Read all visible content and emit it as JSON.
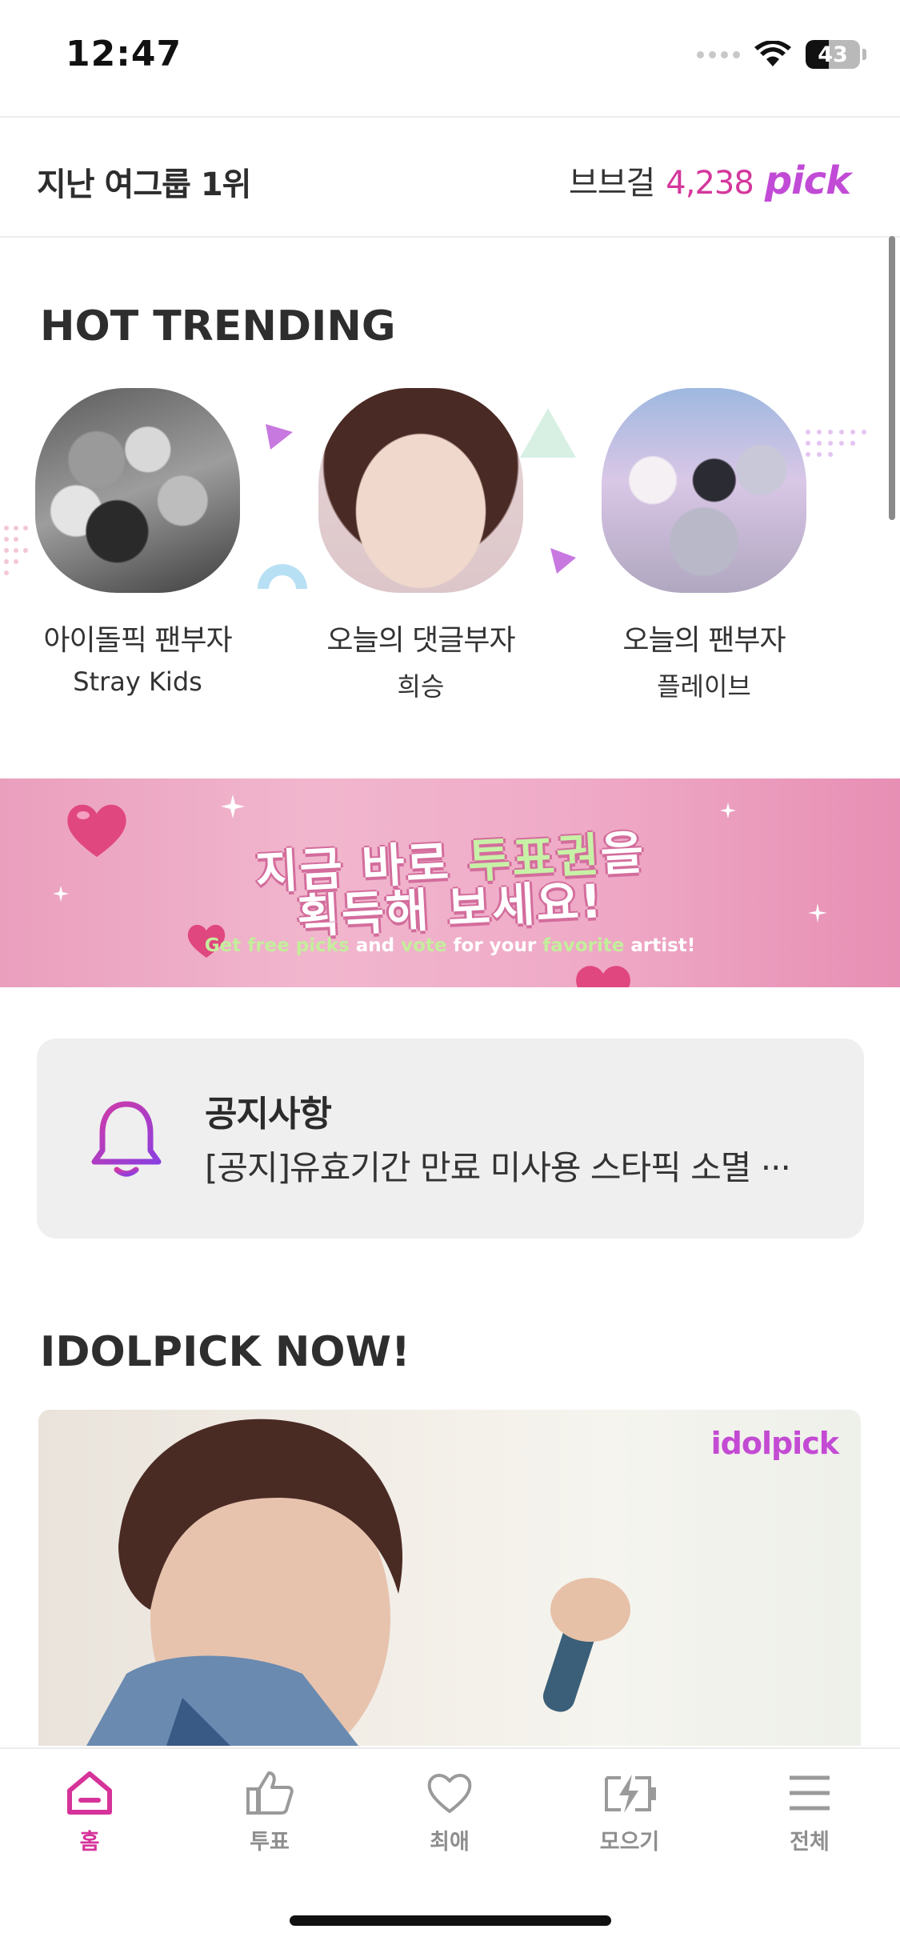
{
  "status_bar": {
    "time": "12:47",
    "battery": "43",
    "battery_level": 0.43
  },
  "last_winner": {
    "label": "지난 여그룹 1위",
    "name": "브브걸",
    "count": "4,238",
    "pick_logo": "pick"
  },
  "hot_trending": {
    "title": "HOT TRENDING",
    "items": [
      {
        "title": "아이돌픽 팬부자",
        "subtitle": "Stray Kids"
      },
      {
        "title": "오늘의 댓글부자",
        "subtitle": "희승"
      },
      {
        "title": "오늘의 팬부자",
        "subtitle": "플레이브"
      }
    ]
  },
  "banner": {
    "line1_a": "지금 바로 ",
    "line1_b": "투표권",
    "line1_c": "을",
    "line2": "획득해 보세요!",
    "sub_a": "Get free picks",
    "sub_b": " and ",
    "sub_c": "vote",
    "sub_d": " for your ",
    "sub_e": "favorite",
    "sub_f": " artist!"
  },
  "notice": {
    "title": "공지사항",
    "text": "[공지]유효기간 만료 미사용 스타픽 소멸 ···"
  },
  "idolpick_now": {
    "title": "IDOLPICK NOW!",
    "logo": "idolpick"
  },
  "tabs": [
    {
      "label": "홈",
      "icon": "home-icon",
      "active": true
    },
    {
      "label": "투표",
      "icon": "thumbs-up-icon",
      "active": false
    },
    {
      "label": "최애",
      "icon": "heart-icon",
      "active": false
    },
    {
      "label": "모으기",
      "icon": "battery-charge-icon",
      "active": false
    },
    {
      "label": "전체",
      "icon": "menu-icon",
      "active": false
    }
  ],
  "colors": {
    "accent": "#d6339a",
    "pick_purple": "#c14bd6",
    "inactive_tab": "#8e8e8e",
    "banner_pink": "#efaac7"
  }
}
